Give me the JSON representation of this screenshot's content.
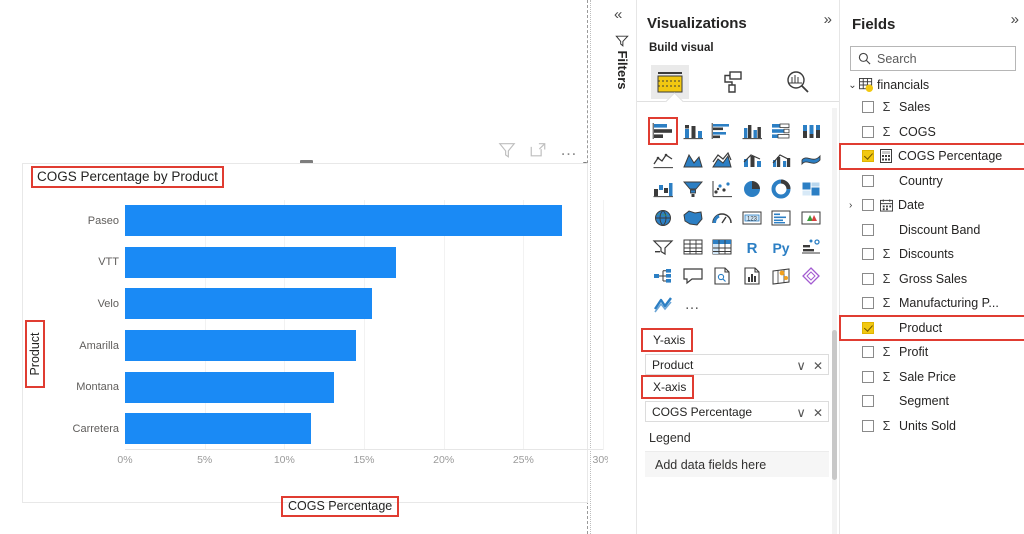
{
  "canvas": {
    "visual_toolbar": {
      "filter_icon": "filter-icon",
      "focus_icon": "focus-mode-icon",
      "more_options": "…"
    }
  },
  "chart_data": {
    "type": "bar",
    "orientation": "horizontal",
    "title": "COGS Percentage by Product",
    "xlabel": "COGS Percentage",
    "ylabel": "Product",
    "categories": [
      "Paseo",
      "VTT",
      "Velo",
      "Amarilla",
      "Montana",
      "Carretera"
    ],
    "values": [
      27.4,
      17.0,
      15.5,
      14.5,
      13.1,
      11.7
    ],
    "xlim": [
      0,
      30
    ],
    "xticks": [
      "0%",
      "5%",
      "10%",
      "15%",
      "20%",
      "25%",
      "30%"
    ],
    "xtick_values": [
      0,
      5,
      10,
      15,
      20,
      25,
      30
    ],
    "series_color": "#1A8AF5",
    "grid": true,
    "legend": "none"
  },
  "filters_rail": {
    "collapse_label": "«",
    "filter_icon": "filter-icon",
    "label": "Filters"
  },
  "visualizations": {
    "title": "Visualizations",
    "expand_label": "»",
    "section_label": "Build visual",
    "tabs": [
      {
        "name": "build-visual-tab",
        "icon": "fields-grid-icon",
        "selected": true
      },
      {
        "name": "format-visual-tab",
        "icon": "paint-roller-icon",
        "selected": false
      },
      {
        "name": "analytics-tab",
        "icon": "magnifier-chart-icon",
        "selected": false
      }
    ],
    "viz_types": [
      {
        "name": "stacked-bar-chart",
        "selected": true
      },
      {
        "name": "stacked-column-chart",
        "selected": false
      },
      {
        "name": "clustered-bar-chart",
        "selected": false
      },
      {
        "name": "clustered-column-chart",
        "selected": false
      },
      {
        "name": "100-stacked-bar-chart",
        "selected": false
      },
      {
        "name": "100-stacked-column-chart",
        "selected": false
      },
      {
        "name": "line-chart",
        "selected": false
      },
      {
        "name": "area-chart",
        "selected": false
      },
      {
        "name": "stacked-area-chart",
        "selected": false
      },
      {
        "name": "line-stacked-column-chart",
        "selected": false
      },
      {
        "name": "line-clustered-column-chart",
        "selected": false
      },
      {
        "name": "ribbon-chart",
        "selected": false
      },
      {
        "name": "waterfall-chart",
        "selected": false
      },
      {
        "name": "funnel-chart",
        "selected": false
      },
      {
        "name": "scatter-chart",
        "selected": false
      },
      {
        "name": "pie-chart",
        "selected": false
      },
      {
        "name": "donut-chart",
        "selected": false
      },
      {
        "name": "treemap",
        "selected": false
      },
      {
        "name": "map",
        "selected": false
      },
      {
        "name": "filled-map",
        "selected": false
      },
      {
        "name": "gauge",
        "selected": false
      },
      {
        "name": "card",
        "selected": false
      },
      {
        "name": "multi-row-card",
        "selected": false
      },
      {
        "name": "kpi",
        "selected": false
      },
      {
        "name": "slicer",
        "selected": false
      },
      {
        "name": "table",
        "selected": false
      },
      {
        "name": "matrix",
        "selected": false
      },
      {
        "name": "r-script-visual",
        "selected": false
      },
      {
        "name": "python-visual",
        "selected": false
      },
      {
        "name": "key-influencers",
        "selected": false
      },
      {
        "name": "decomposition-tree",
        "selected": false
      },
      {
        "name": "qa-visual",
        "selected": false
      },
      {
        "name": "smart-narrative",
        "selected": false
      },
      {
        "name": "paginated-report",
        "selected": false
      },
      {
        "name": "azure-map",
        "selected": false
      },
      {
        "name": "power-apps",
        "selected": false
      },
      {
        "name": "power-automate",
        "selected": false
      }
    ],
    "more_visuals": "…",
    "wells": [
      {
        "label": "Y-axis",
        "label_highlighted": true,
        "chip": "Product",
        "chip_highlighted": true,
        "dropdown_icon": "chevron-down-icon",
        "remove_icon": "✕"
      },
      {
        "label": "X-axis",
        "label_highlighted": true,
        "chip": "COGS Percentage",
        "chip_highlighted": true,
        "dropdown_icon": "chevron-down-icon",
        "remove_icon": "✕"
      }
    ],
    "legend_well": {
      "label": "Legend",
      "placeholder": "Add data fields here"
    }
  },
  "fields": {
    "title": "Fields",
    "expand_label": "»",
    "search": {
      "placeholder": "Search",
      "value": "",
      "icon": "search-icon"
    },
    "table": {
      "name": "financials",
      "expanded": true,
      "chevron": "⌄"
    },
    "items": [
      {
        "name": "Sales",
        "checked": false,
        "aggregate": true,
        "expandable": false,
        "highlighted": false,
        "icon": "none"
      },
      {
        "name": "COGS",
        "checked": false,
        "aggregate": true,
        "expandable": false,
        "highlighted": false,
        "icon": "none"
      },
      {
        "name": "COGS Percentage",
        "checked": true,
        "aggregate": false,
        "expandable": false,
        "highlighted": true,
        "icon": "measure-icon"
      },
      {
        "name": "Country",
        "checked": false,
        "aggregate": false,
        "expandable": false,
        "highlighted": false,
        "icon": "none"
      },
      {
        "name": "Date",
        "checked": false,
        "aggregate": false,
        "expandable": true,
        "highlighted": false,
        "icon": "calendar-icon"
      },
      {
        "name": "Discount Band",
        "checked": false,
        "aggregate": false,
        "expandable": false,
        "highlighted": false,
        "icon": "none"
      },
      {
        "name": "Discounts",
        "checked": false,
        "aggregate": true,
        "expandable": false,
        "highlighted": false,
        "icon": "none"
      },
      {
        "name": "Gross Sales",
        "checked": false,
        "aggregate": true,
        "expandable": false,
        "highlighted": false,
        "icon": "none"
      },
      {
        "name": "Manufacturing P...",
        "checked": false,
        "aggregate": true,
        "expandable": false,
        "highlighted": false,
        "icon": "none"
      },
      {
        "name": "Product",
        "checked": true,
        "aggregate": false,
        "expandable": false,
        "highlighted": true,
        "icon": "none"
      },
      {
        "name": "Profit",
        "checked": false,
        "aggregate": true,
        "expandable": false,
        "highlighted": false,
        "icon": "none"
      },
      {
        "name": "Sale Price",
        "checked": false,
        "aggregate": true,
        "expandable": false,
        "highlighted": false,
        "icon": "none"
      },
      {
        "name": "Segment",
        "checked": false,
        "aggregate": false,
        "expandable": false,
        "highlighted": false,
        "icon": "none"
      },
      {
        "name": "Units Sold",
        "checked": false,
        "aggregate": true,
        "expandable": false,
        "highlighted": false,
        "icon": "none"
      }
    ]
  },
  "colors": {
    "bar": "#1A8AF5",
    "highlight": "#e03c31",
    "checkbox_on": "#F2C811"
  }
}
